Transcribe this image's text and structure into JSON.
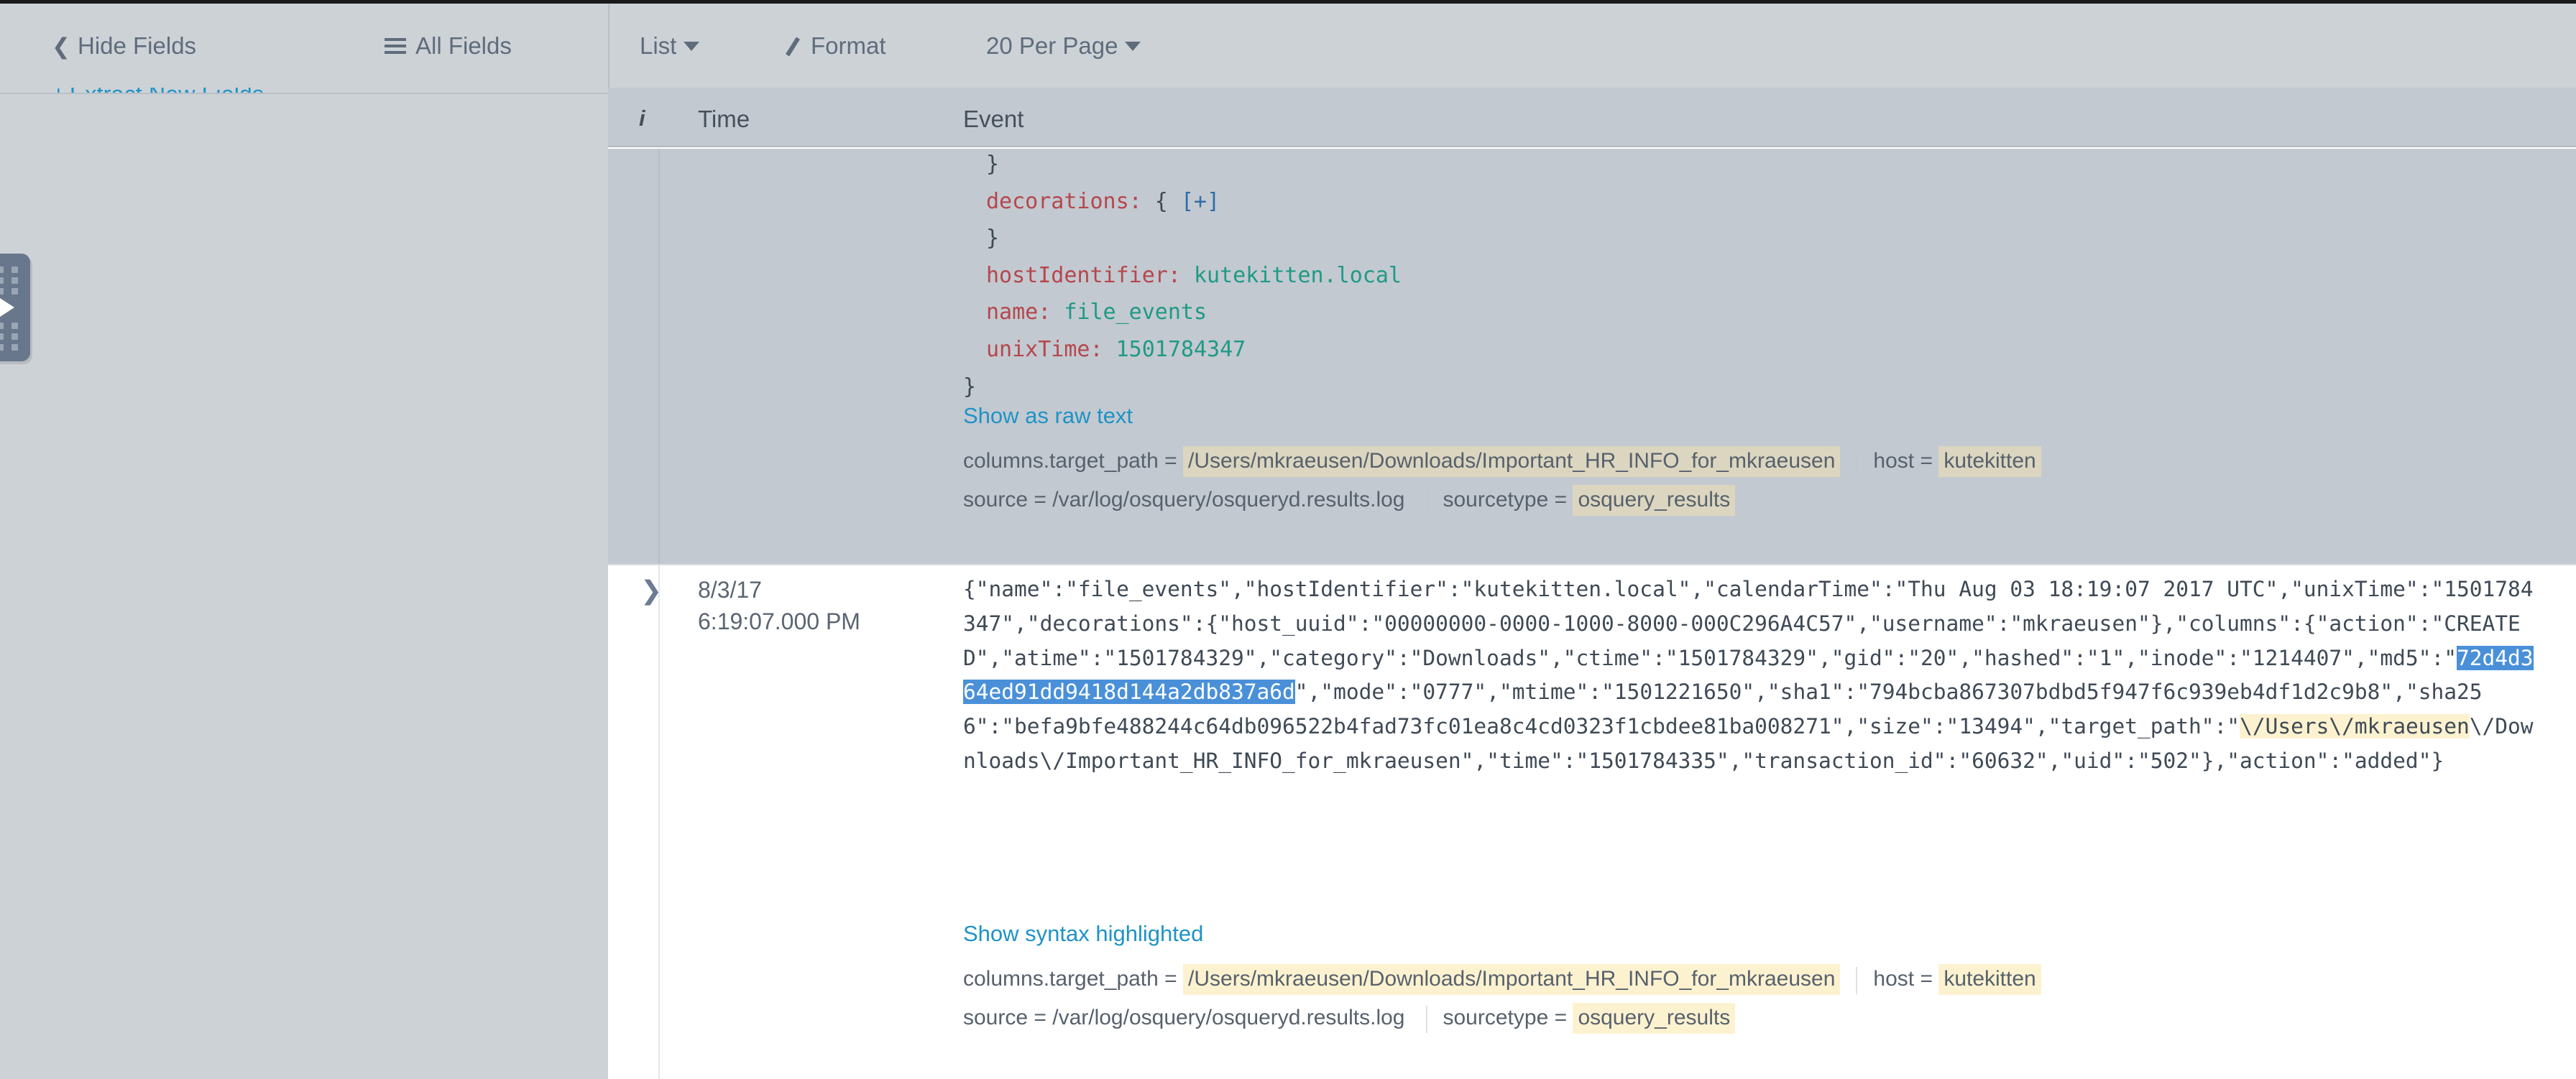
{
  "toolbar": {
    "hide_fields_label": "Hide Fields",
    "hide_fields_chevron": "chevron-left-icon",
    "all_fields_label": "All Fields",
    "all_fields_icon": "list-lines-icon",
    "list_label": "List",
    "format_label": "Format",
    "format_icon": "pencil-icon",
    "per_page_label": "20 Per Page",
    "caret_icon": "caret-down-icon"
  },
  "sidebar": {
    "extract_new_fields_label": "Extract New Fields",
    "extract_prefix": "+",
    "panel_handle": "expand-panel-handle"
  },
  "columns": {
    "info": "i",
    "time": "Time",
    "event": "Event"
  },
  "rows": [
    {
      "selected": true,
      "mode": "syntax",
      "time_date": "",
      "time_clock": "",
      "json_lines": [
        {
          "indent": 1,
          "parts": [
            {
              "t": "}",
              "c": "p"
            }
          ]
        },
        {
          "indent": 1,
          "parts": [
            {
              "t": "decorations:",
              "c": "k"
            },
            {
              "t": " { ",
              "c": "p"
            },
            {
              "t": "[+]",
              "c": "br"
            }
          ]
        },
        {
          "indent": 1,
          "parts": [
            {
              "t": "}",
              "c": "p"
            }
          ]
        },
        {
          "indent": 1,
          "parts": [
            {
              "t": "hostIdentifier:",
              "c": "k"
            },
            {
              "t": " ",
              "c": "p"
            },
            {
              "t": "kutekitten.local",
              "c": "v"
            }
          ]
        },
        {
          "indent": 1,
          "parts": [
            {
              "t": "name:",
              "c": "k"
            },
            {
              "t": " ",
              "c": "p"
            },
            {
              "t": "file_events",
              "c": "v"
            }
          ]
        },
        {
          "indent": 1,
          "parts": [
            {
              "t": "unixTime:",
              "c": "k"
            },
            {
              "t": " ",
              "c": "p"
            },
            {
              "t": "1501784347",
              "c": "v"
            }
          ]
        },
        {
          "indent": 0,
          "parts": [
            {
              "t": "}",
              "c": "p"
            }
          ]
        }
      ],
      "toggle_link": "Show as raw text",
      "tags_line1": [
        {
          "key": "columns.target_path = ",
          "value": "/Users/mkraeusen/Downloads/Important_HR_INFO_for_mkraeusen",
          "style": "tan"
        },
        {
          "key": "host = ",
          "value": "kutekitten",
          "style": "tan"
        }
      ],
      "tags_line2": [
        {
          "key": "source = ",
          "value": "/var/log/osquery/osqueryd.results.log",
          "style": "plain"
        },
        {
          "key": "sourcetype = ",
          "value": "osquery_results",
          "style": "tan"
        }
      ]
    },
    {
      "selected": false,
      "mode": "raw",
      "expand_icon": "chevron-right-icon",
      "time_date": "8/3/17",
      "time_clock": "6:19:07.000 PM",
      "raw_segments": [
        {
          "t": "{\"name\":\"file_events\",\"hostIdentifier\":\"kutekitten.local\",\"calendarTime\":\"Thu Aug 03 18:19:07 2017 UTC\",\"unixTime\":\"1501784347\",\"decorations\":{\"host_uuid\":\"00000000-0000-1000-8000-000C296A4C57\",\"username\":\"mkraeusen\"},\"columns\":{\"action\":\"CREATED\",\"atime\":\"1501784329\",\"category\":\"Downloads\",\"ctime\":\"1501784329\",\"gid\":\"20\",\"hashed\":\"1\",\"inode\":\"1214407\",\"md5\":\"",
          "style": "none"
        },
        {
          "t": "72d4d364ed91dd9418d144a2db837a6d",
          "style": "selection"
        },
        {
          "t": "\",\"mode\":\"0777\",\"mtime\":\"1501221650\",\"sha1\":\"794bcba867307bdbd5f947f6c939eb4df1d2c9b8\",\"sha256\":\"befa9bfe488244c64db096522b4fad73fc01ea8c4cd0323f1cbdee81ba008271\",\"size\":\"13494\",\"target_path\":\"",
          "style": "none"
        },
        {
          "t": "\\/Users\\/mkraeusen",
          "style": "highlight"
        },
        {
          "t": "\\/Downloads\\/Important_HR_INFO_for_mkraeusen\",\"time\":\"1501784335\",\"transaction_id\":\"60632\",\"uid\":\"502\"},\"action\":\"added\"}",
          "style": "none"
        }
      ],
      "toggle_link": "Show syntax highlighted",
      "tags_line1": [
        {
          "key": "columns.target_path = ",
          "value": "/Users/mkraeusen/Downloads/Important_HR_INFO_for_mkraeusen",
          "style": "cream"
        },
        {
          "key": "host = ",
          "value": "kutekitten",
          "style": "cream"
        }
      ],
      "tags_line2": [
        {
          "key": "source = ",
          "value": "/var/log/osquery/osqueryd.results.log",
          "style": "plain"
        },
        {
          "key": "sourcetype = ",
          "value": "osquery_results",
          "style": "cream"
        }
      ]
    }
  ],
  "colors": {
    "chrome": "#cdd2d7",
    "header_row": "#c3c9d0",
    "link": "#1e93c6",
    "json_key": "#b5474d",
    "json_value": "#1f9a86",
    "json_bracket": "#2e6ea8",
    "selection_blue": "#4a90d9",
    "tag_tan": "#dcd6c0",
    "tag_cream": "#fdf2d0"
  }
}
